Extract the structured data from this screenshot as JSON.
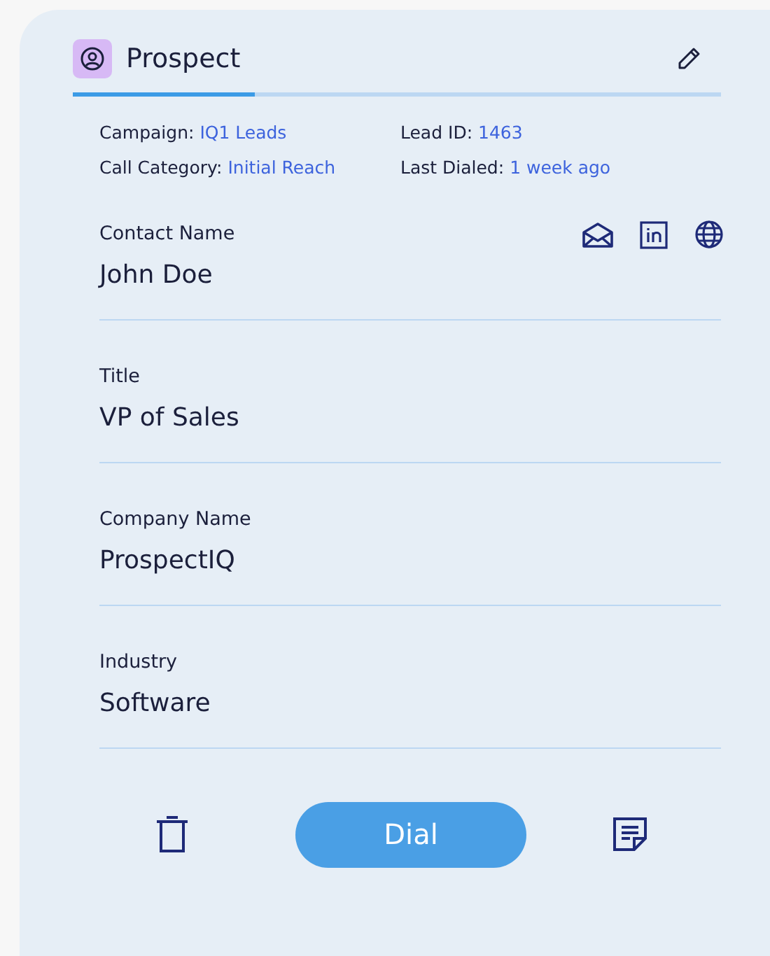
{
  "header": {
    "title": "Prospect",
    "progress": {
      "level": 0.28
    }
  },
  "meta": [
    {
      "label": "Campaign:",
      "value": "IQ1 Leads"
    },
    {
      "label": "Lead ID:",
      "value": "1463"
    },
    {
      "label": "Call Category:",
      "value": "Initial Reach"
    },
    {
      "label": "Last Dialed:",
      "value": "1 week ago"
    }
  ],
  "fields": [
    {
      "label": "Contact Name",
      "value": "John Doe",
      "links": true
    },
    {
      "label": "Title",
      "value": "VP of Sales",
      "links": false
    },
    {
      "label": "Company Name",
      "value": "ProspectIQ",
      "links": false
    },
    {
      "label": "Industry",
      "value": "Software",
      "links": false
    }
  ],
  "actions": {
    "primary": "Dial"
  }
}
